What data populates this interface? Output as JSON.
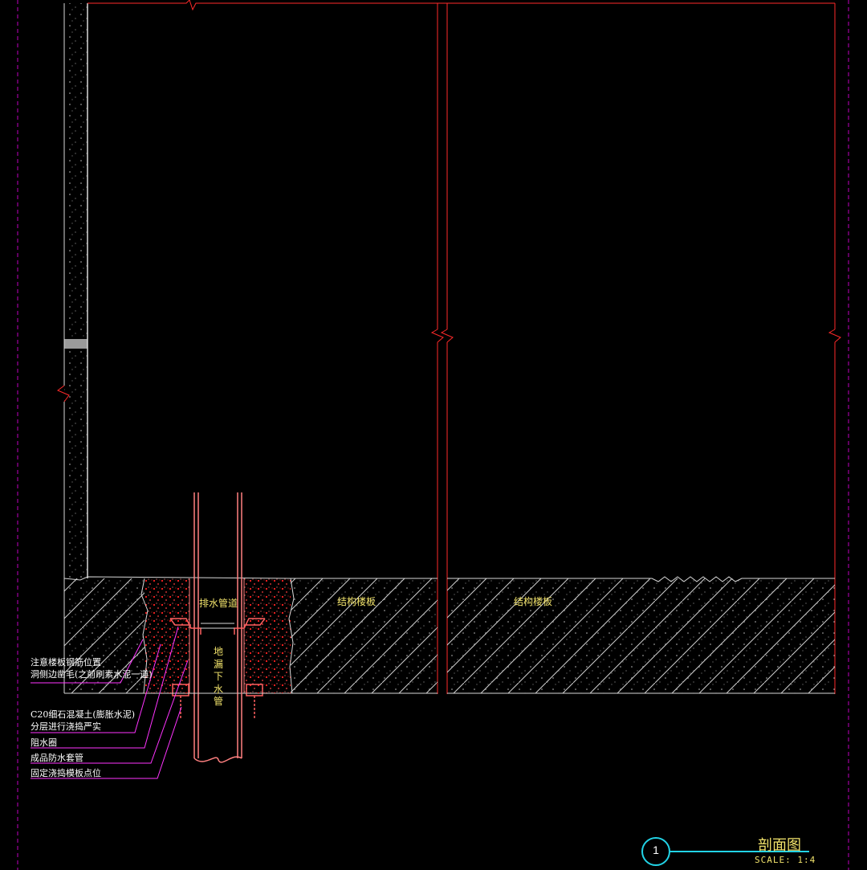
{
  "labels": {
    "drain_channel": "排水管道",
    "drain_pipe": [
      "地",
      "漏",
      "下",
      "水",
      "管"
    ],
    "slab_left": "结构楼板",
    "slab_right": "结构楼板"
  },
  "callouts": [
    {
      "lines": [
        "注意楼板钢筋位置",
        "洞侧边凿毛(之前刷素水泥一道)"
      ]
    },
    {
      "lines": [
        "C20细石混凝土(膨胀水泥)",
        "分层进行浇捣严实"
      ]
    },
    {
      "lines": [
        "阻水圈"
      ]
    },
    {
      "lines": [
        "成品防水套管"
      ]
    },
    {
      "lines": [
        "固定浇捣模板点位"
      ]
    }
  ],
  "title_block": {
    "number": "1",
    "title": "剖面图",
    "scale": "SCALE: 1:4"
  },
  "colors": {
    "background": "#000000",
    "outline_red": "#ff2a2a",
    "pipe": "#ff8080",
    "concrete_white": "#d8d8d8",
    "hatch": "#cfcfcf",
    "callout_magenta": "#ff33ff",
    "callout_text": "#ffffff",
    "label_yellow": "#f2e36b",
    "title_cyan": "#22d3e6",
    "title_yellow": "#f2e36b",
    "boundary_magenta": "#c000c0"
  }
}
